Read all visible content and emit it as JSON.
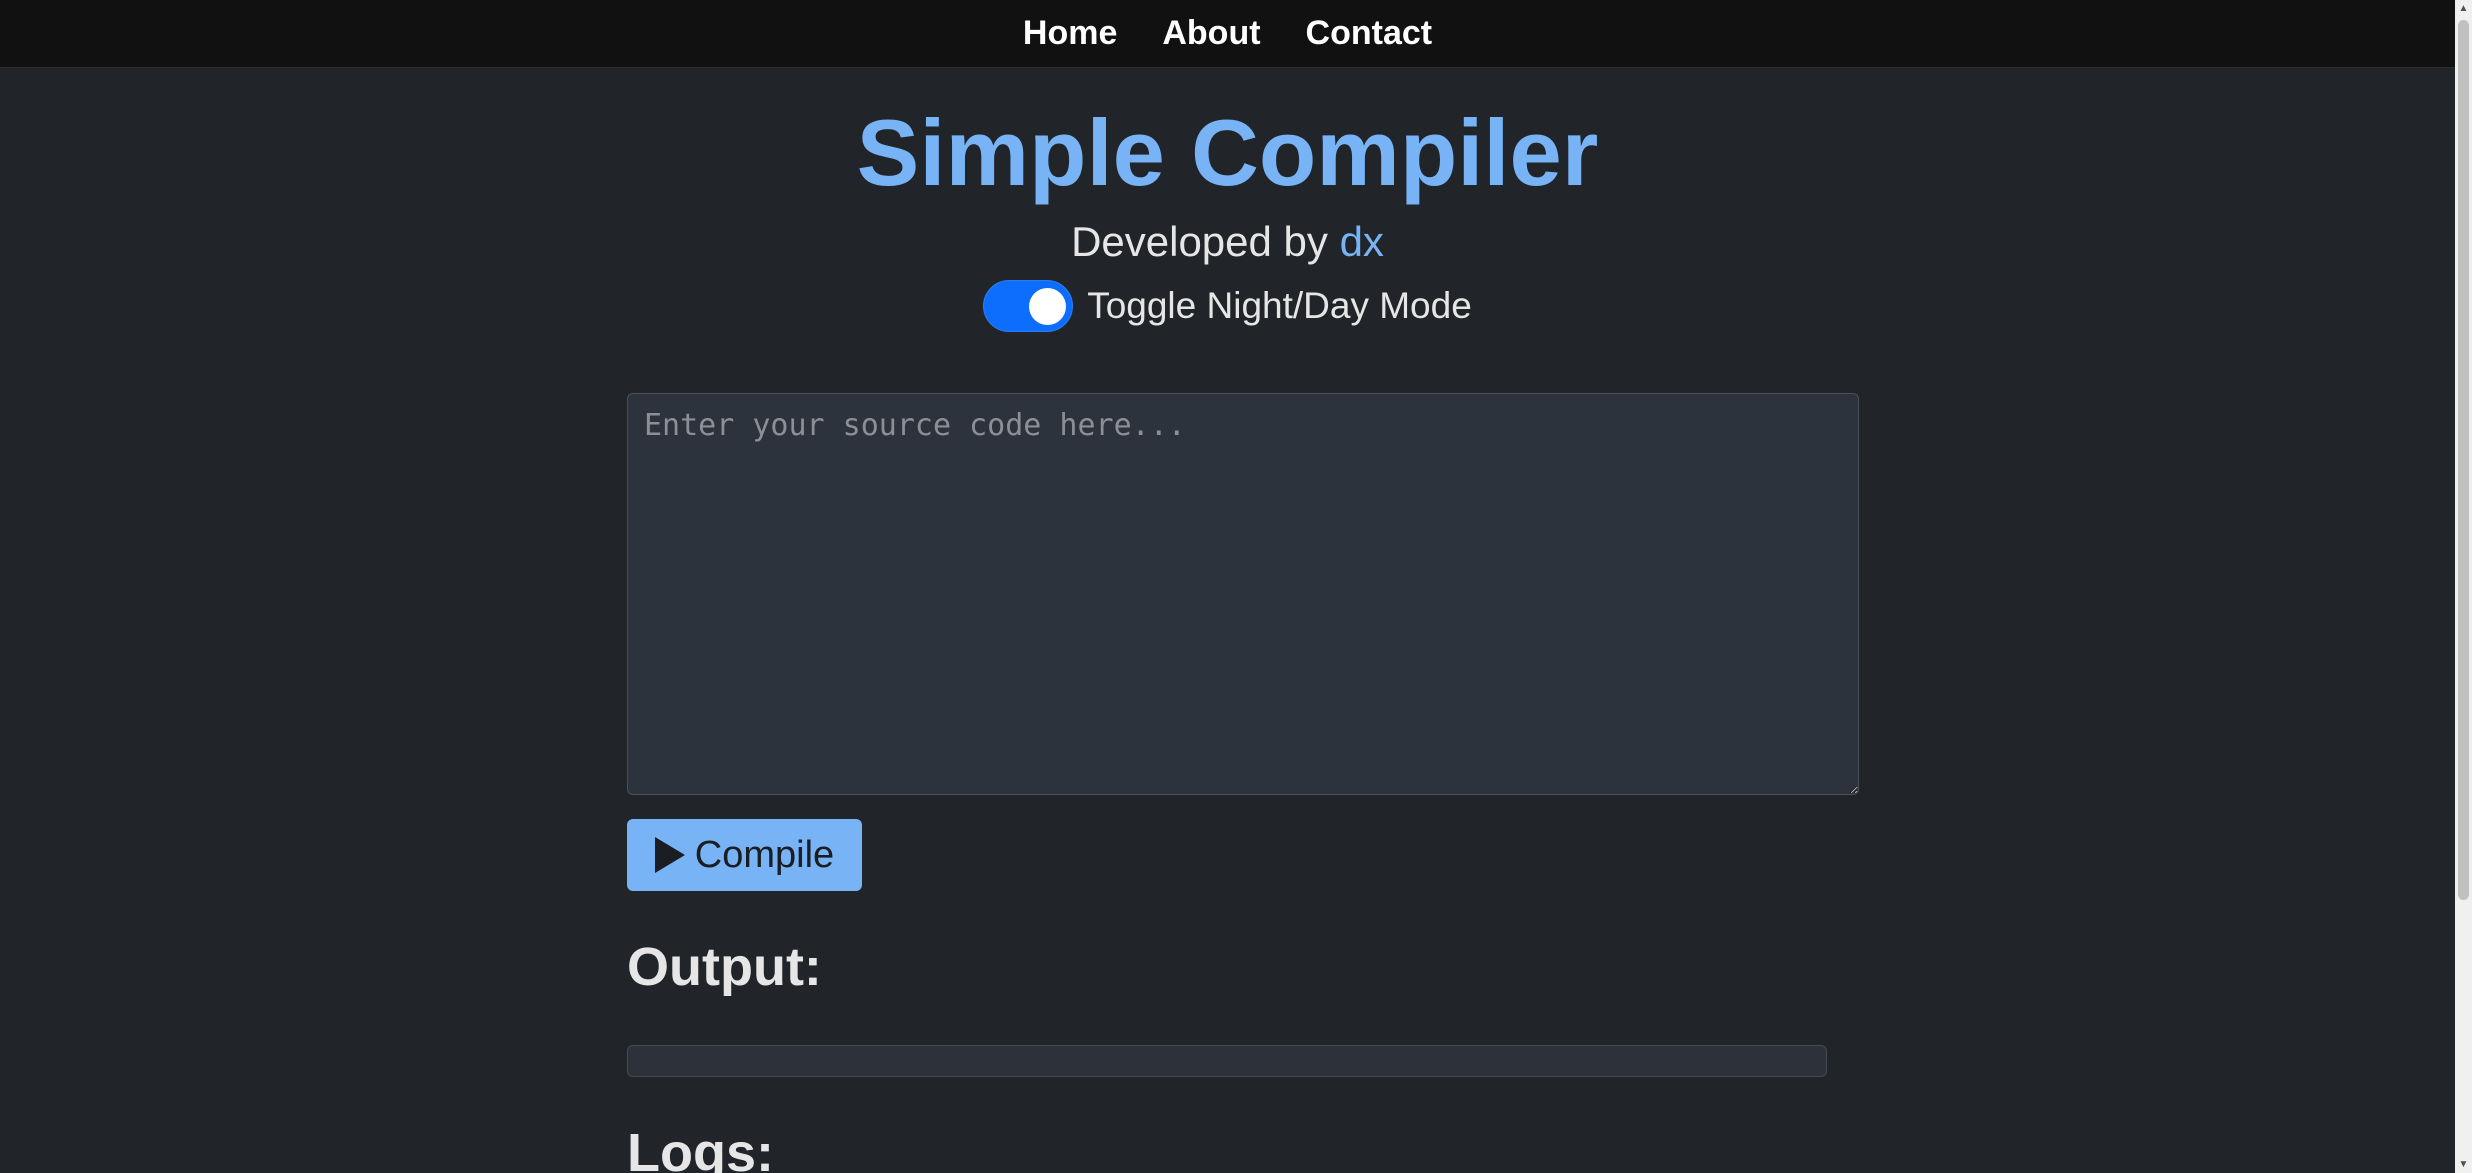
{
  "nav": {
    "items": [
      {
        "label": "Home"
      },
      {
        "label": "About"
      },
      {
        "label": "Contact"
      }
    ]
  },
  "header": {
    "title": "Simple Compiler",
    "subtitle_prefix": "Developed by ",
    "author": "dx"
  },
  "toggle": {
    "label": "Toggle Night/Day Mode",
    "checked": true
  },
  "editor": {
    "value": "",
    "placeholder": "Enter your source code here..."
  },
  "compile_button": {
    "label": "Compile",
    "icon": "play-icon"
  },
  "sections": {
    "output_heading": "Output:",
    "logs_heading": "Logs:"
  },
  "colors": {
    "accent": "#77b3f5",
    "background": "#212529",
    "navbar": "#111111",
    "toggle_on": "#0d6efd"
  }
}
